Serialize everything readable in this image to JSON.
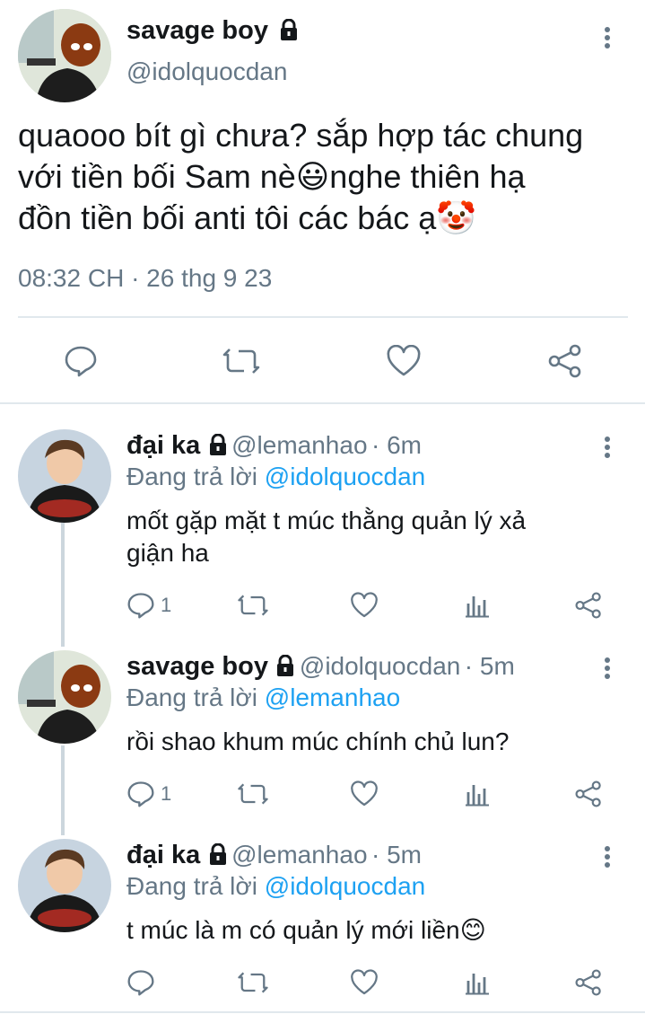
{
  "main_tweet": {
    "name": "savage boy",
    "handle": "@idolquocdan",
    "text_lines": [
      "quaooo bít gì chưa? sắp hợp tác chung",
      "với tiền bối Sam nè😃nghe thiên hạ",
      "đồn tiền bối anti tôi các bác ạ🤡"
    ],
    "meta": "08:32 CH · 26 thg 9 23",
    "icons": [
      "reply-icon",
      "retweet-icon",
      "like-icon",
      "share-icon"
    ]
  },
  "replies": [
    {
      "name": "đại ka",
      "handle": "@lemanhao",
      "time": "· 6m",
      "replying_prefix": "Đang trả lời",
      "replying_to": "@idolquocdan",
      "text_lines": [
        "mốt gặp mặt t múc thằng quản lý xả",
        "giận ha"
      ],
      "reply_count": "1"
    },
    {
      "name": "savage boy",
      "handle": "@idolquocdan",
      "time": "· 5m",
      "replying_prefix": "Đang trả lời",
      "replying_to": "@lemanhao",
      "text_lines": [
        "rồi shao khum múc chính chủ lun?"
      ],
      "reply_count": "1"
    },
    {
      "name": "đại ka",
      "handle": "@lemanhao",
      "time": "· 5m",
      "replying_prefix": "Đang trả lời",
      "replying_to": "@idolquocdan",
      "text_lines": [
        "t múc là m có quản lý mới liền😊"
      ],
      "reply_count": ""
    }
  ],
  "colors": {
    "text": "#14171a",
    "secondary": "#657786",
    "link": "#1da1f2",
    "divider": "#e1e8ed",
    "thread_line": "#ccd6dd"
  }
}
